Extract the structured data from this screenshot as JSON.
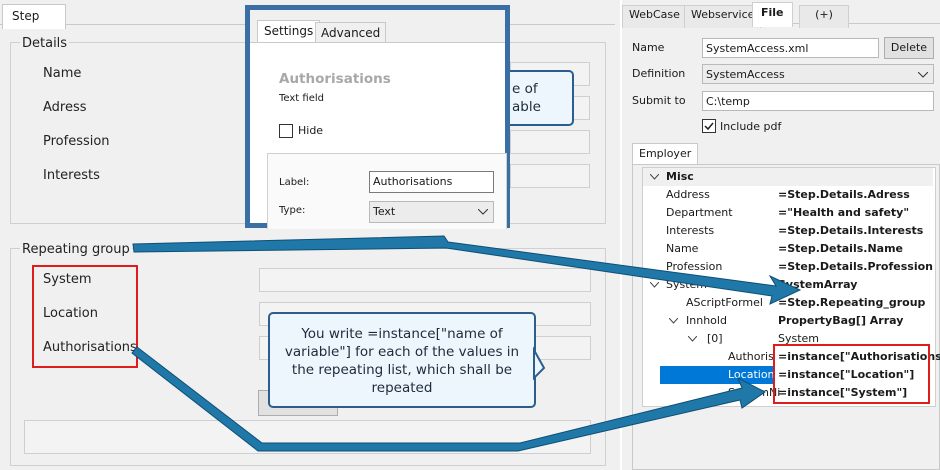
{
  "left_tab": "Step",
  "details": {
    "legend": "Details",
    "fields": [
      {
        "label": "Name"
      },
      {
        "label": "Adress"
      },
      {
        "label": "Profession"
      },
      {
        "label": "Interests"
      }
    ]
  },
  "repeating": {
    "legend": "Repeating group",
    "fields": [
      {
        "label": "System"
      },
      {
        "label": "Location"
      },
      {
        "label": "Authorisations"
      }
    ]
  },
  "popup": {
    "tabs": [
      "Settings",
      "Advanced"
    ],
    "title": "Authorisations",
    "subtitle": "Text field",
    "hide_label": "Hide",
    "label_caption": "Label:",
    "label_value": "Authorisations",
    "type_caption": "Type:",
    "type_value": "Text"
  },
  "behind_callout": {
    "line1": "e of",
    "line2": "able"
  },
  "callout": {
    "text": "You write =instance[\"name of variable\"] for each of the values in the repeating list, which shall be repeated"
  },
  "right": {
    "tabs": [
      "WebCase",
      "Webservice",
      "File",
      "(+)"
    ],
    "name_label": "Name",
    "name_value": "SystemAccess.xml",
    "delete_label": "Delete",
    "definition_label": "Definition",
    "definition_value": "SystemAccess",
    "submit_label": "Submit to",
    "submit_value": "C:\\temp",
    "include_pdf_label": "Include pdf",
    "include_pdf_checked": true,
    "inner_tab": "Employer",
    "grid": {
      "section": "Misc",
      "rows": [
        {
          "key": "Address",
          "value": "=Step.Details.Adress"
        },
        {
          "key": "Department",
          "value": "=\"Health and safety\""
        },
        {
          "key": "Interests",
          "value": "=Step.Details.Interests"
        },
        {
          "key": "Name",
          "value": "=Step.Details.Name"
        },
        {
          "key": "Profession",
          "value": "=Step.Details.Profession"
        },
        {
          "key": "System",
          "value": "SystemArray"
        },
        {
          "key": "AScriptFormel",
          "value": "=Step.Repeating_group"
        },
        {
          "key": "Innhold",
          "value": "PropertyBag[] Array"
        },
        {
          "key": "[0]",
          "value": "System"
        },
        {
          "key": "Authoris",
          "value": "=instance[\"Authorisations\"]"
        },
        {
          "key": "Location",
          "value": "=instance[\"Location\"]"
        },
        {
          "key": "SystemNi",
          "value": "=instance[\"System\"]"
        }
      ]
    }
  },
  "colors": {
    "arrow": "#1f78a8",
    "red": "#e11c1c",
    "popup_border": "#3a6fa5",
    "selected": "#0078d7"
  }
}
